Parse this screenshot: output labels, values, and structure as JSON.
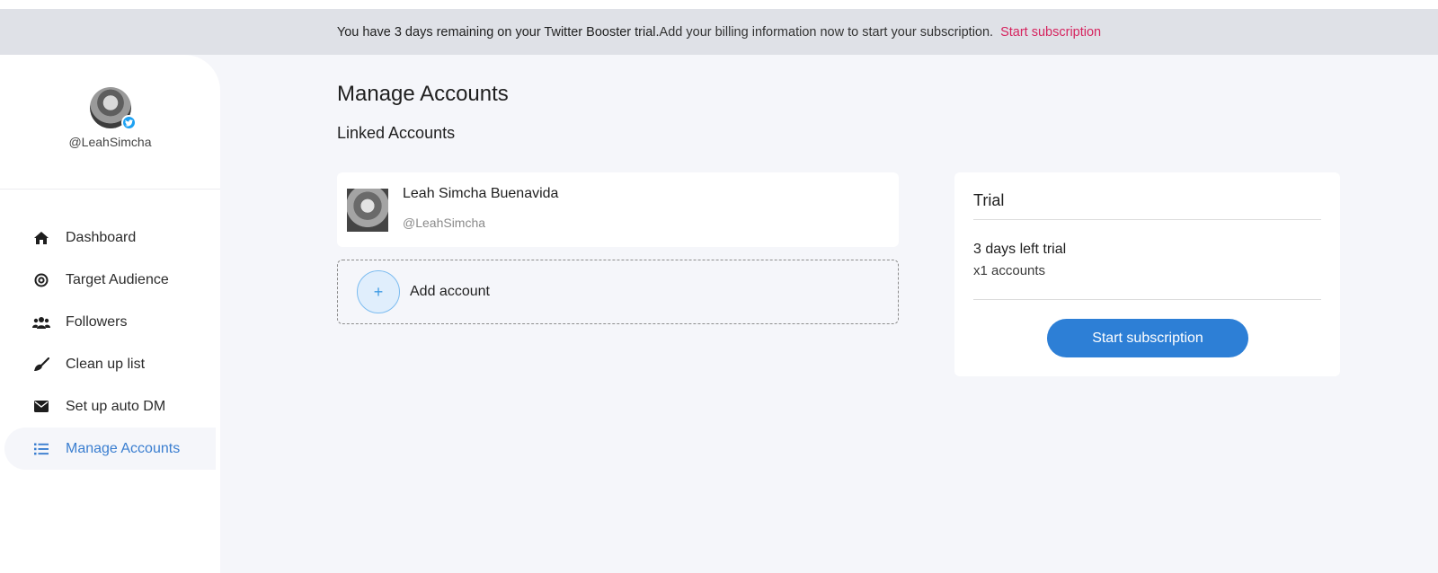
{
  "banner": {
    "strong": "You have 3 days remaining on your Twitter Booster trial.",
    "message": "Add your billing information now to start your subscription.",
    "link": "Start subscription"
  },
  "profile": {
    "handle": "@LeahSimcha",
    "badge_icon": "twitter-icon"
  },
  "sidebar": {
    "items": [
      {
        "label": "Dashboard",
        "icon": "home-icon",
        "active": false
      },
      {
        "label": "Target Audience",
        "icon": "target-icon",
        "active": false
      },
      {
        "label": "Followers",
        "icon": "users-icon",
        "active": false
      },
      {
        "label": "Clean up list",
        "icon": "broom-icon",
        "active": false
      },
      {
        "label": "Set up auto DM",
        "icon": "envelope-icon",
        "active": false
      },
      {
        "label": "Manage Accounts",
        "icon": "list-icon",
        "active": true
      }
    ]
  },
  "main": {
    "title": "Manage Accounts",
    "section": "Linked Accounts",
    "account": {
      "name": "Leah Simcha Buenavida",
      "handle": "@LeahSimcha"
    },
    "add": {
      "symbol": "+",
      "label": "Add account"
    }
  },
  "trial": {
    "title": "Trial",
    "days": "3 days left trial",
    "accounts": "x1 accounts",
    "button": "Start subscription"
  },
  "colors": {
    "accent": "#2d7fd6",
    "active_nav": "#3a7ed0",
    "banner_link": "#d6245f",
    "banner_bg": "#dfe1e7",
    "page_bg": "#f5f6fa"
  }
}
